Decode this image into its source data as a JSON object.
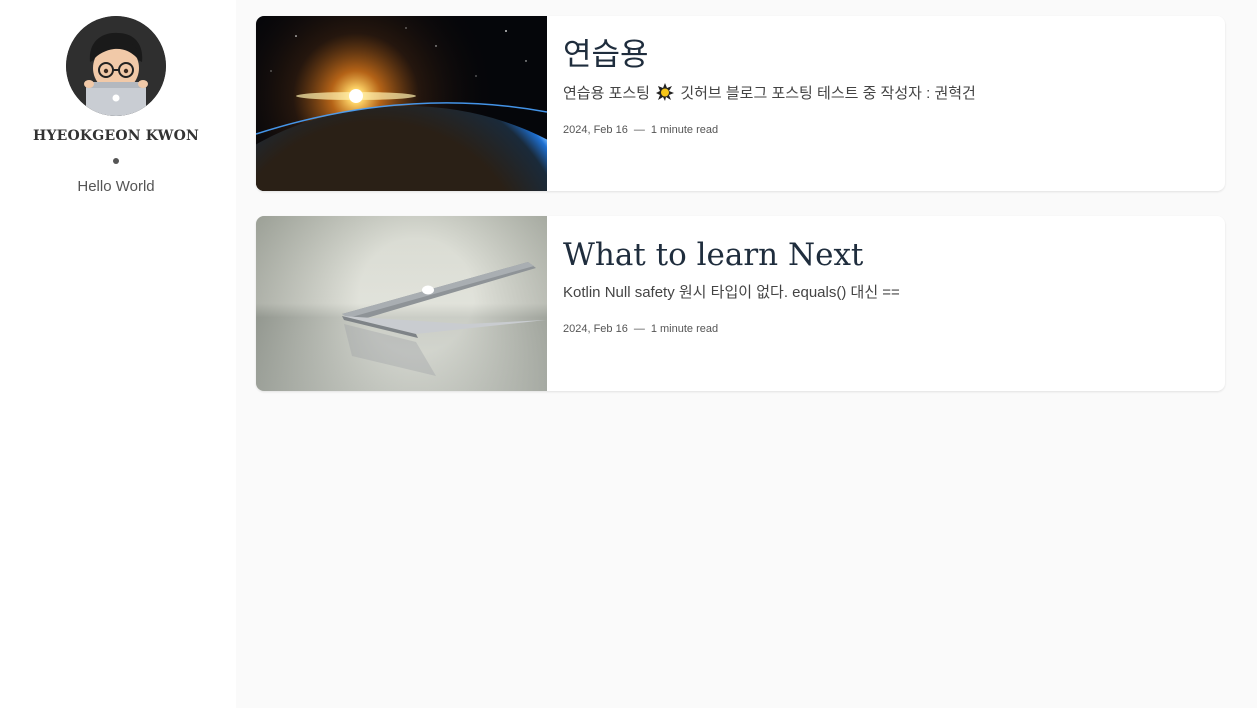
{
  "author": {
    "name": "HYEOKGEON KWON",
    "bio": "Hello World"
  },
  "posts": [
    {
      "title": "연습용",
      "excerpt_before_icon": "연습용 포스팅",
      "excerpt_after_icon": "깃허브 블로그 포스팅 테스트 중 작성자 : 권혁건",
      "excerpt_icon": "warning-burst-icon",
      "date": "2024, Feb 16",
      "separator": "—",
      "read_time": "1 minute read"
    },
    {
      "title": "What to learn Next",
      "excerpt": "Kotlin Null safety 원시 타입이 없다. equals() 대신 ==",
      "date": "2024, Feb 16",
      "separator": "—",
      "read_time": "1 minute read"
    }
  ],
  "colors": {
    "sidebar_bg": "#ffffff",
    "main_bg": "#fafafa",
    "title": "#1f2d3d",
    "text": "#444444"
  }
}
